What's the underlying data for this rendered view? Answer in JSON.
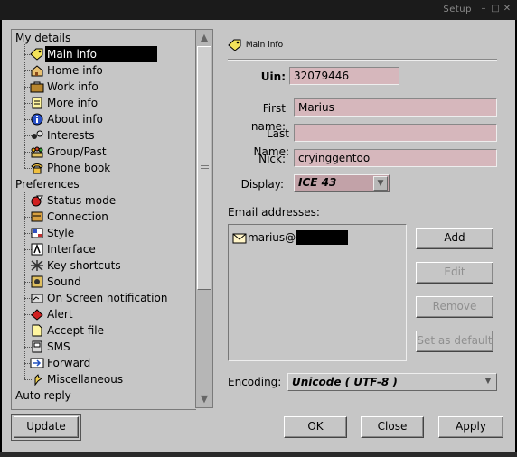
{
  "window": {
    "title": "Setup"
  },
  "tree": {
    "groups": [
      {
        "label": "My details",
        "items": [
          {
            "label": "Main info",
            "icon": "tag-icon",
            "selected": true
          },
          {
            "label": "Home info",
            "icon": "house-icon"
          },
          {
            "label": "Work info",
            "icon": "briefcase-icon"
          },
          {
            "label": "More info",
            "icon": "note-icon"
          },
          {
            "label": "About info",
            "icon": "info-icon"
          },
          {
            "label": "Interests",
            "icon": "interests-icon"
          },
          {
            "label": "Group/Past",
            "icon": "group-icon"
          },
          {
            "label": "Phone book",
            "icon": "phone-icon"
          }
        ]
      },
      {
        "label": "Preferences",
        "items": [
          {
            "label": "Status mode",
            "icon": "status-icon"
          },
          {
            "label": "Connection",
            "icon": "connection-icon"
          },
          {
            "label": "Style",
            "icon": "style-icon"
          },
          {
            "label": "Interface",
            "icon": "interface-icon"
          },
          {
            "label": "Key shortcuts",
            "icon": "keyboard-icon"
          },
          {
            "label": "Sound",
            "icon": "sound-icon"
          },
          {
            "label": "On Screen notification",
            "icon": "osd-icon"
          },
          {
            "label": "Alert",
            "icon": "alert-icon"
          },
          {
            "label": "Accept file",
            "icon": "file-icon"
          },
          {
            "label": "SMS",
            "icon": "sms-icon"
          },
          {
            "label": "Forward",
            "icon": "forward-icon"
          },
          {
            "label": "Miscellaneous",
            "icon": "misc-icon"
          }
        ]
      },
      {
        "label": "Auto reply",
        "items": []
      }
    ]
  },
  "panel": {
    "section_title": "Main info",
    "uin_label": "Uin:",
    "uin_value": "32079446",
    "first_name_label": "First name:",
    "first_name_value": "Marius",
    "last_name_label": "Last Name:",
    "last_name_value": "",
    "nick_label": "Nick:",
    "nick_value": "cryinggentoo",
    "display_label": "Display:",
    "display_value": "ICE 43",
    "email_label": "Email addresses:",
    "emails": [
      "marius@"
    ],
    "add_label": "Add",
    "edit_label": "Edit",
    "remove_label": "Remove",
    "set_default_label": "Set as default",
    "encoding_label": "Encoding:",
    "encoding_value": "Unicode ( UTF-8 )"
  },
  "footer": {
    "update_label": "Update",
    "ok_label": "OK",
    "close_label": "Close",
    "apply_label": "Apply"
  },
  "colors": {
    "field_bg": "#d6b7bc",
    "panel_bg": "#c6c6c6",
    "selection_bg": "#000000"
  }
}
